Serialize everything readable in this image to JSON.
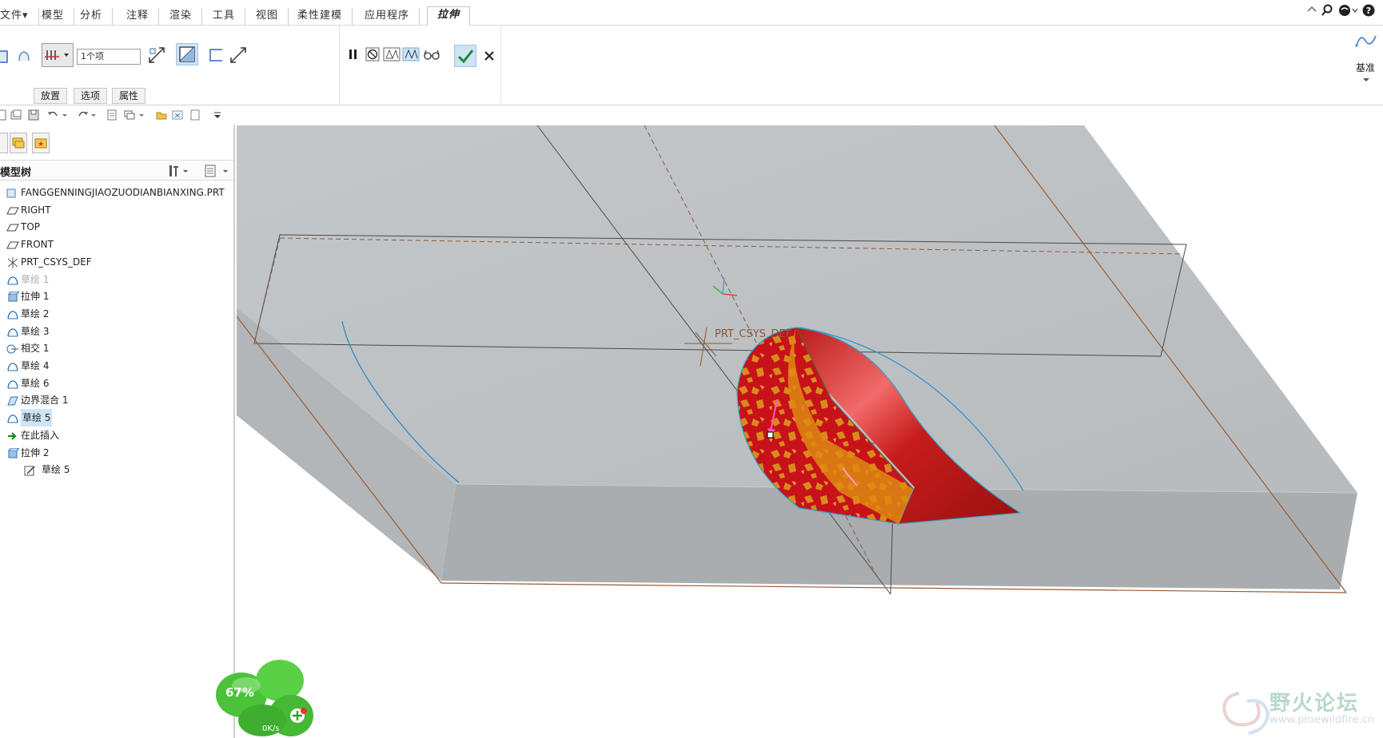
{
  "menu": {
    "tabs": [
      {
        "label": "文件",
        "caret": "▾"
      },
      {
        "label": "模型"
      },
      {
        "label": "分析"
      },
      {
        "label": "注释"
      },
      {
        "label": "渲染"
      },
      {
        "label": "工具"
      },
      {
        "label": "视图"
      },
      {
        "label": "柔性建模"
      },
      {
        "label": "应用程序"
      },
      {
        "label": "拉伸",
        "active": true
      }
    ]
  },
  "ribbon": {
    "items_field": "1个项",
    "subtabs": [
      "放置",
      "选项",
      "属性"
    ],
    "datum_label": "基准"
  },
  "tree": {
    "title": "模型树",
    "items": [
      {
        "label": "FANGGENNINGJIAOZUODIANBIANXING.PRT",
        "icon": "part-icon"
      },
      {
        "label": "RIGHT",
        "icon": "plane-icon"
      },
      {
        "label": "TOP",
        "icon": "plane-icon"
      },
      {
        "label": "FRONT",
        "icon": "plane-icon"
      },
      {
        "label": "PRT_CSYS_DEF",
        "icon": "csys-icon"
      },
      {
        "label": "草绘 1",
        "icon": "sketch-icon",
        "state": "disabled"
      },
      {
        "label": "拉伸 1",
        "icon": "extrude-icon"
      },
      {
        "label": "草绘 2",
        "icon": "sketch-icon"
      },
      {
        "label": "草绘 3",
        "icon": "sketch-icon"
      },
      {
        "label": "相交 1",
        "icon": "intersect-icon"
      },
      {
        "label": "草绘 4",
        "icon": "sketch-icon"
      },
      {
        "label": "草绘 6",
        "icon": "sketch-icon"
      },
      {
        "label": "边界混合 1",
        "icon": "boundary-blend-icon"
      },
      {
        "label": "草绘 5",
        "icon": "sketch-icon",
        "state": "selected"
      },
      {
        "label": "在此插入",
        "icon": "insert-arrow-icon"
      },
      {
        "label": "拉伸 2",
        "icon": "extrude-icon"
      },
      {
        "label": "草绘 5",
        "icon": "sketch-edit-icon"
      }
    ]
  },
  "graphics": {
    "csys_label": "PRT_CSYS_DEF"
  },
  "widgets": {
    "clover_percent": "67%",
    "clover_speed": "0K/s",
    "watermark_cn": "野火论坛",
    "watermark_url": "www.proewildfire.cn"
  }
}
